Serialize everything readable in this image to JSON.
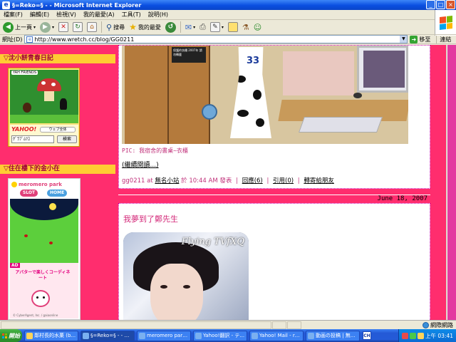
{
  "window": {
    "title": "§=Reko=§ - - Microsoft Internet Explorer",
    "controls": {
      "minimize": "_",
      "maximize": "□",
      "close": "×"
    }
  },
  "menu": {
    "items": [
      "檔案(F)",
      "編輯(E)",
      "檢視(V)",
      "我的最愛(A)",
      "工具(T)",
      "說明(H)"
    ]
  },
  "toolbar": {
    "back": "上一頁",
    "search": "搜尋",
    "favorites": "我的最愛"
  },
  "address": {
    "label": "網址(D)",
    "url": "http://www.wretch.cc/blog/GG0211",
    "go": "移至",
    "links": "連結"
  },
  "sidebar": {
    "section1_title": "▽沈小餅青春日記",
    "widget1": {
      "tag": "YAH FRIENDS",
      "brand": "YAHOO!",
      "button": "ウェブ全体",
      "search_value": "ｸﾞﾗﾌﾞﾑﾂﾕ",
      "search_button": "検索"
    },
    "section2_title": "▽住在樓下的金小在",
    "widget2": {
      "logo": "meromero park",
      "slot": "SLOT",
      "home": "HOME",
      "ad_tag": "AD",
      "ad_text": "アバターで楽しくコーディネート",
      "copyright": "© CyberAgent, Inc. / gaiaonline"
    }
  },
  "post1": {
    "poster_text": "保護的衣櫃 2007年 請勿轉載",
    "shirt_number": "33",
    "caption": "PIC: 我宿舍的書桌~衣櫃",
    "read_more": "(繼續閱讀...)",
    "meta": {
      "author": "gg0211",
      "at": "at",
      "blog": "無名小站",
      "time_prefix": "於",
      "time": "10:44 AM",
      "published": "發表",
      "reply": "回應(6)",
      "trackback": "引用(0)",
      "share": "轉寄給朋友"
    }
  },
  "post2": {
    "date": "June 18, 2007",
    "title": "我夢到了鄭先生",
    "image_text": "Flying TVfXQ"
  },
  "status": {
    "zone": "網際網路"
  },
  "taskbar": {
    "start": "開始",
    "tasks": [
      {
        "label": "鄰村長的水菓 (b...",
        "active": false
      },
      {
        "label": "§=Reko=§ - - Micr...",
        "active": true
      },
      {
        "label": "meromero park - ...",
        "active": false
      },
      {
        "label": "Yahoo!翻訳 - テ...",
        "active": false
      },
      {
        "label": "Yahoo! Mail - roc...",
        "active": false
      },
      {
        "label": "動画の投稿 | 無...",
        "active": false
      }
    ],
    "lang": "CH",
    "clock": "上午 03:41"
  },
  "colors": {
    "page_bg": "#ff2d6e",
    "sidebar_header": "#ffcc33",
    "accent_text": "#c0307a"
  }
}
